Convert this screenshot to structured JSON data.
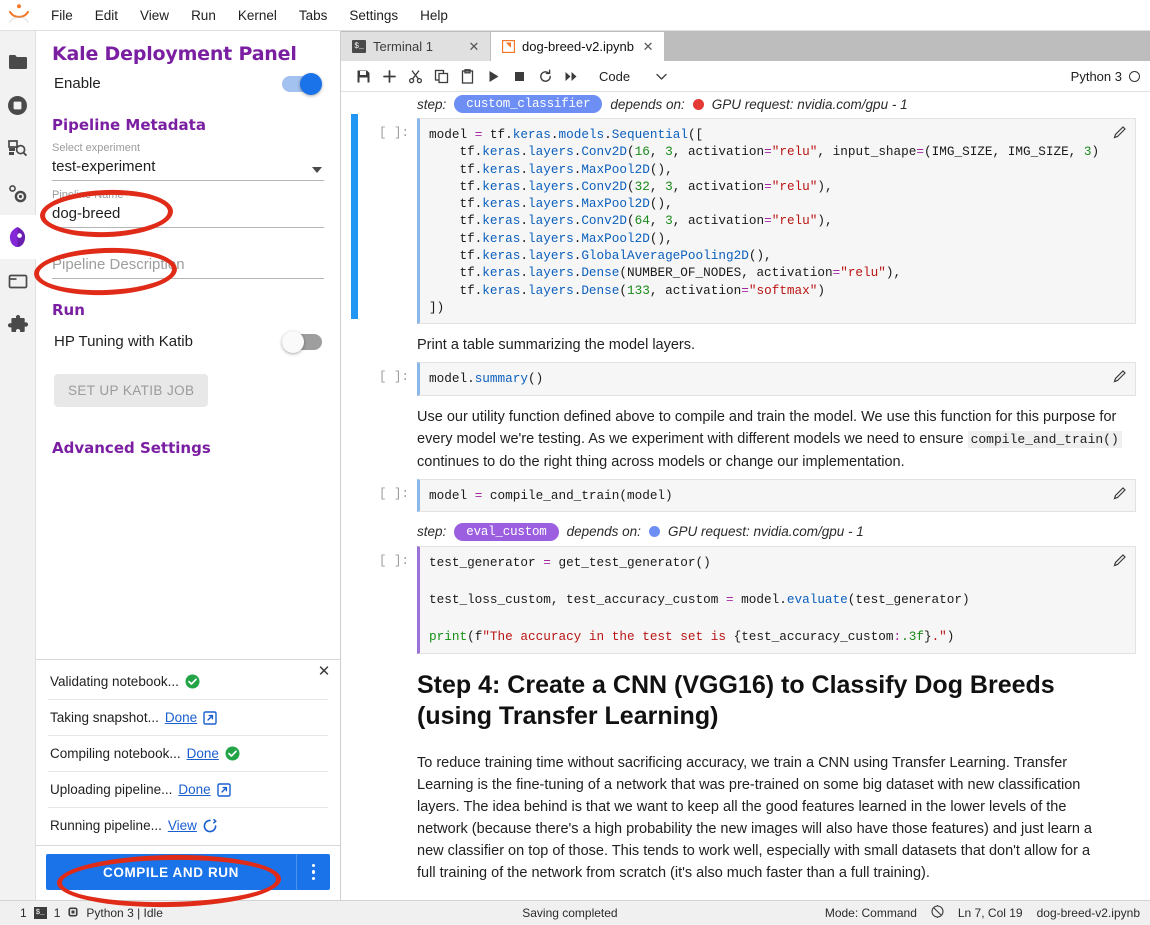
{
  "menubar": {
    "logo_name": "jupyter-logo",
    "items": [
      "File",
      "Edit",
      "View",
      "Run",
      "Kernel",
      "Tabs",
      "Settings",
      "Help"
    ]
  },
  "activitybar": {
    "items": [
      {
        "name": "file-browser-icon",
        "label": "File Browser",
        "active": false
      },
      {
        "name": "running-terminals-icon",
        "label": "Running Terminals and Kernels",
        "active": false
      },
      {
        "name": "commands-icon",
        "label": "Commands",
        "active": false
      },
      {
        "name": "property-inspector-icon",
        "label": "Property Inspector",
        "active": false
      },
      {
        "name": "kale-icon",
        "label": "Kale Deployment Panel",
        "active": true
      },
      {
        "name": "open-tabs-icon",
        "label": "Open Tabs",
        "active": false
      },
      {
        "name": "extension-manager-icon",
        "label": "Extension Manager",
        "active": false
      }
    ]
  },
  "kale": {
    "title": "Kale Deployment Panel",
    "enable_label": "Enable",
    "enable_state": "on",
    "metadata_heading": "Pipeline Metadata",
    "experiment": {
      "label": "Select experiment",
      "value": "test-experiment"
    },
    "pipeline_name": {
      "label": "Pipeline Name",
      "value": "dog-breed"
    },
    "pipeline_description": {
      "label": "Pipeline Description",
      "placeholder": "Pipeline Description",
      "value": ""
    },
    "run_heading": "Run",
    "katib_label": "HP Tuning with Katib",
    "katib_state": "off",
    "katib_button": "SET UP KATIB JOB",
    "advanced_heading": "Advanced Settings",
    "log": {
      "close_icon": "close-icon",
      "rows": [
        {
          "text": "Validating notebook...",
          "link": "",
          "icon": "check-circle-icon"
        },
        {
          "text": "Taking snapshot...",
          "link": "Done",
          "icon": "external-link-icon"
        },
        {
          "text": "Compiling notebook...",
          "link": "Done",
          "icon": "check-circle-icon"
        },
        {
          "text": "Uploading pipeline...",
          "link": "Done",
          "icon": "external-link-icon"
        },
        {
          "text": "Running pipeline...",
          "link": "View",
          "icon": "spinner-icon"
        }
      ]
    },
    "compile_run_label": "COMPILE AND RUN",
    "menu_icon": "kebab-menu-icon"
  },
  "tabs": [
    {
      "label": "Terminal 1",
      "icon": "terminal-icon",
      "active": false,
      "close_icon": "close-icon"
    },
    {
      "label": "dog-breed-v2.ipynb",
      "icon": "notebook-icon",
      "active": true,
      "close_icon": "close-icon"
    }
  ],
  "toolbar": {
    "buttons": [
      {
        "name": "save-button",
        "icon": "save-icon"
      },
      {
        "name": "insert-cell-button",
        "icon": "plus-icon"
      },
      {
        "name": "cut-button",
        "icon": "scissors-icon"
      },
      {
        "name": "copy-button",
        "icon": "copy-icon"
      },
      {
        "name": "paste-button",
        "icon": "paste-icon"
      },
      {
        "name": "run-button",
        "icon": "play-icon"
      },
      {
        "name": "stop-button",
        "icon": "stop-icon"
      },
      {
        "name": "restart-button",
        "icon": "restart-icon"
      },
      {
        "name": "restart-run-all-button",
        "icon": "fast-forward-icon"
      }
    ],
    "celltype_value": "Code",
    "celltype_caret": "chevron-down-icon",
    "kernel_name": "Python 3",
    "kernel_status_icon": "kernel-idle-circle"
  },
  "notebook": {
    "cells": [
      {
        "type": "step-header",
        "step_label": "step:",
        "step_name": "custom_classifier",
        "chip_color": "#6c8ef5",
        "depends_label": "depends on:",
        "dep_dot_color": "#e53935",
        "gpu_text": "GPU request: nvidia.com/gpu - 1"
      },
      {
        "type": "code",
        "prompt": "[ ]:",
        "accent": "#8bb8e8",
        "lines": [
          "model = tf.keras.models.Sequential([",
          "    tf.keras.layers.Conv2D(16, 3, activation=\"relu\", input_shape=(IMG_SIZE, IMG_SIZE, 3)",
          "    tf.keras.layers.MaxPool2D(),",
          "    tf.keras.layers.Conv2D(32, 3, activation=\"relu\"),",
          "    tf.keras.layers.MaxPool2D(),",
          "    tf.keras.layers.Conv2D(64, 3, activation=\"relu\"),",
          "    tf.keras.layers.MaxPool2D(),",
          "    tf.keras.layers.GlobalAveragePooling2D(),",
          "    tf.keras.layers.Dense(NUMBER_OF_NODES, activation=\"relu\"),",
          "    tf.keras.layers.Dense(133, activation=\"softmax\")",
          "])"
        ]
      },
      {
        "type": "markdown",
        "text": "Print a table summarizing the model layers."
      },
      {
        "type": "code",
        "prompt": "[ ]:",
        "accent": "#8bb8e8",
        "lines": [
          "model.summary()"
        ]
      },
      {
        "type": "markdown",
        "text": "Use our utility function defined above to compile and train the model. We use this function for this purpose for every model we're testing. As we experiment with different models we need to ensure compile_and_train() continues to do the right thing across models or change our implementation."
      },
      {
        "type": "code",
        "prompt": "[ ]:",
        "accent": "#8bb8e8",
        "lines": [
          "model = compile_and_train(model)"
        ]
      },
      {
        "type": "step-header",
        "step_label": "step:",
        "step_name": "eval_custom",
        "chip_color": "#9b5fe0",
        "depends_label": "depends on:",
        "dep_dot_color": "#6c8ef5",
        "gpu_text": "GPU request: nvidia.com/gpu - 1"
      },
      {
        "type": "code",
        "prompt": "[ ]:",
        "accent": "#9b72d8",
        "lines": [
          "test_generator = get_test_generator()",
          "",
          "test_loss_custom, test_accuracy_custom = model.evaluate(test_generator)",
          "",
          "print(f\"The accuracy in the test set is {test_accuracy_custom:.3f}.\")"
        ]
      },
      {
        "type": "heading",
        "text": "Step 4: Create a CNN (VGG16) to Classify Dog Breeds (using Transfer Learning)"
      },
      {
        "type": "markdown",
        "text": "To reduce training time without sacrificing accuracy, we train a CNN using Transfer Learning. Transfer Learning is the fine-tuning of a network that was pre-trained on some big dataset with new classification layers. The idea behind is that we want to keep all the good features learned in the lower levels of the network (because there's a high probability the new images will also have those features) and just learn a new classifier on top of those. This tends to work well, especially with small datasets that don't allow for a full training of the network from scratch (it's also much faster than a full training)."
      }
    ]
  },
  "statusbar": {
    "terminal_count": "1",
    "terminal_icon": "terminal-icon",
    "kernel_count": "1",
    "kernel_icon": "kernel-chip-icon",
    "kernel_text": "Python 3 | Idle",
    "save_status": "Saving completed",
    "mode": "Mode: Command",
    "no_cell_icon": "no-kernel-icon",
    "cursor": "Ln 7, Col 19",
    "filename": "dog-breed-v2.ipynb"
  },
  "annotations": {
    "color": "#e02b18",
    "shapes": [
      {
        "name": "annotation-experiment-ellipse"
      },
      {
        "name": "annotation-pipeline-name-ellipse"
      },
      {
        "name": "annotation-compile-run-ellipse"
      }
    ]
  }
}
